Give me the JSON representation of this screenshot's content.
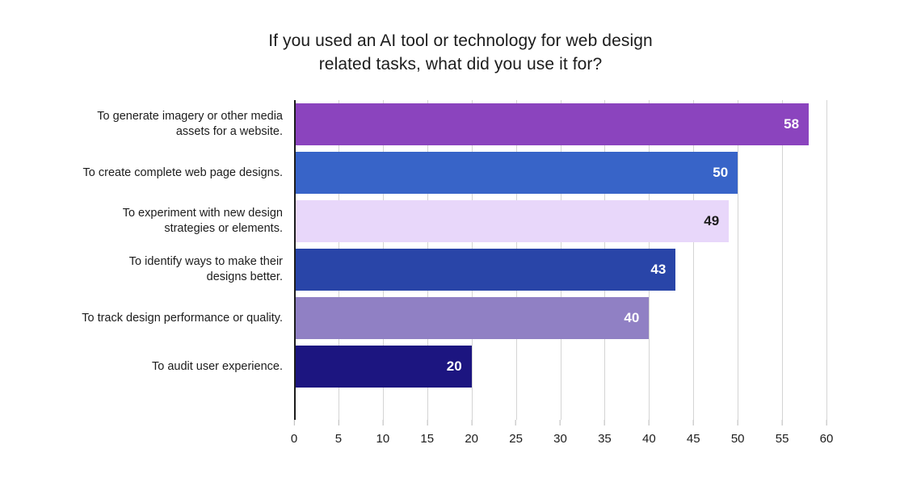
{
  "chart_data": {
    "type": "bar",
    "orientation": "horizontal",
    "title": "If you used an AI tool or technology for web design related tasks, what did you use it for?",
    "title_lines": [
      "If you used an AI tool or technology for web design",
      "related tasks, what did you use it for?"
    ],
    "xlabel": "",
    "ylabel": "",
    "xlim": [
      0,
      60
    ],
    "xticks": [
      0,
      5,
      10,
      15,
      20,
      25,
      30,
      35,
      40,
      45,
      50,
      55,
      60
    ],
    "xtick_labels": [
      "0",
      "5",
      "10",
      "15",
      "20",
      "25",
      "30",
      "35",
      "40",
      "45",
      "50",
      "55",
      "60"
    ],
    "grid": "vertical",
    "legend": "none",
    "categories": [
      "To generate imagery or other media assets for a website.",
      "To create complete web page designs.",
      "To experiment with new design strategies or elements.",
      "To identify ways to make their designs better.",
      "To track design performance or quality.",
      "To audit user experience."
    ],
    "category_lines": [
      [
        "To generate imagery or other media",
        "assets for a website."
      ],
      [
        "To create complete web page designs."
      ],
      [
        "To experiment with new design",
        "strategies or elements."
      ],
      [
        "To identify ways to make their",
        "designs better."
      ],
      [
        "To track design performance or quality."
      ],
      [
        "To audit user experience."
      ]
    ],
    "values": [
      58,
      50,
      49,
      43,
      40,
      20
    ],
    "value_labels": [
      "58",
      "50",
      "49",
      "43",
      "40",
      "20"
    ],
    "bar_colors": [
      "#8B44BE",
      "#3864C8",
      "#E8D7FA",
      "#2945A8",
      "#9080C4",
      "#1C1580"
    ],
    "value_label_colors": [
      "#ffffff",
      "#ffffff",
      "#1c1c1c",
      "#ffffff",
      "#ffffff",
      "#ffffff"
    ]
  },
  "colors": {
    "background": "#ffffff",
    "text": "#1c1c1c",
    "gridline": "#d4d4d4",
    "axis_line": "#1c1c1c"
  }
}
